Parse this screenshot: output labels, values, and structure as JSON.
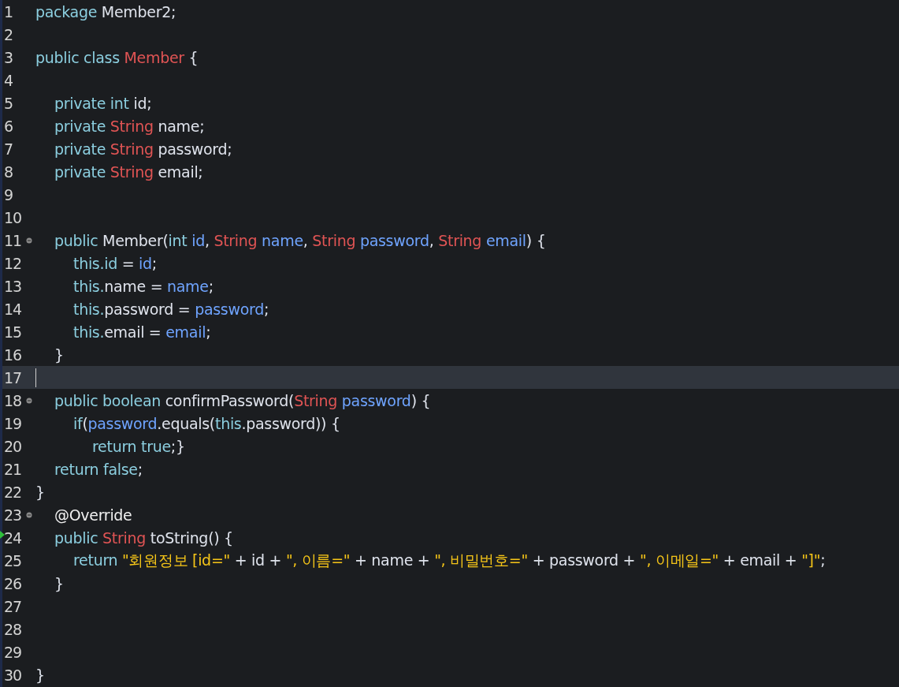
{
  "editor": {
    "lines": [
      {
        "number": "1",
        "tokens": [
          {
            "text": "package",
            "kind": "kw"
          },
          {
            "text": " Member2;",
            "kind": "plain"
          }
        ]
      },
      {
        "number": "2"
      },
      {
        "number": "3",
        "tokens": [
          {
            "text": "public class ",
            "kind": "kw"
          },
          {
            "text": "Member",
            "kind": "type"
          },
          {
            "text": " {",
            "kind": "plain"
          }
        ]
      },
      {
        "number": "4"
      },
      {
        "number": "5",
        "tokens": [
          {
            "text": "\tprivate int ",
            "kind": "kw"
          },
          {
            "text": "id;",
            "kind": "plain"
          }
        ]
      },
      {
        "number": "6",
        "tokens": [
          {
            "text": "\tprivate ",
            "kind": "kw"
          },
          {
            "text": "String",
            "kind": "type"
          },
          {
            "text": " name;",
            "kind": "plain"
          }
        ]
      },
      {
        "number": "7",
        "tokens": [
          {
            "text": "\tprivate ",
            "kind": "kw"
          },
          {
            "text": "String",
            "kind": "type"
          },
          {
            "text": " password;",
            "kind": "plain"
          }
        ]
      },
      {
        "number": "8",
        "tokens": [
          {
            "text": "\tprivate ",
            "kind": "kw"
          },
          {
            "text": "String",
            "kind": "type"
          },
          {
            "text": " email;",
            "kind": "plain"
          }
        ]
      },
      {
        "number": "9"
      },
      {
        "number": "10"
      },
      {
        "number": "11",
        "fold": true,
        "tokens": [
          {
            "text": "\tpublic ",
            "kind": "kw"
          },
          {
            "text": "Member(",
            "kind": "plain"
          },
          {
            "text": "int ",
            "kind": "kw"
          },
          {
            "text": "id",
            "kind": "param"
          },
          {
            "text": ", ",
            "kind": "plain"
          },
          {
            "text": "String ",
            "kind": "type"
          },
          {
            "text": "name",
            "kind": "param"
          },
          {
            "text": ", ",
            "kind": "plain"
          },
          {
            "text": "String ",
            "kind": "type"
          },
          {
            "text": "password",
            "kind": "param"
          },
          {
            "text": ", ",
            "kind": "plain"
          },
          {
            "text": "String ",
            "kind": "type"
          },
          {
            "text": "email",
            "kind": "param"
          },
          {
            "text": ") {",
            "kind": "plain"
          }
        ]
      },
      {
        "number": "12",
        "tokens": [
          {
            "text": "\t\tthis.id",
            "kind": "kw"
          },
          {
            "text": " = ",
            "kind": "plain"
          },
          {
            "text": "id",
            "kind": "param"
          },
          {
            "text": ";",
            "kind": "plain"
          }
        ]
      },
      {
        "number": "13",
        "tokens": [
          {
            "text": "\t\tthis.",
            "kind": "kw"
          },
          {
            "text": "name = ",
            "kind": "plain"
          },
          {
            "text": "name",
            "kind": "param"
          },
          {
            "text": ";",
            "kind": "plain"
          }
        ]
      },
      {
        "number": "14",
        "tokens": [
          {
            "text": "\t\tthis.",
            "kind": "kw"
          },
          {
            "text": "password = ",
            "kind": "plain"
          },
          {
            "text": "password",
            "kind": "param"
          },
          {
            "text": ";",
            "kind": "plain"
          }
        ]
      },
      {
        "number": "15",
        "tokens": [
          {
            "text": "\t\tthis.",
            "kind": "kw"
          },
          {
            "text": "email = ",
            "kind": "plain"
          },
          {
            "text": "email",
            "kind": "param"
          },
          {
            "text": ";",
            "kind": "plain"
          }
        ]
      },
      {
        "number": "16",
        "tokens": [
          {
            "text": "\t}",
            "kind": "plain"
          }
        ]
      },
      {
        "number": "17",
        "current": true
      },
      {
        "number": "18",
        "fold": true,
        "tokens": [
          {
            "text": "\tpublic boolean ",
            "kind": "kw"
          },
          {
            "text": "confirmPassword(",
            "kind": "plain"
          },
          {
            "text": "String ",
            "kind": "type"
          },
          {
            "text": "password",
            "kind": "param"
          },
          {
            "text": ") {",
            "kind": "plain"
          }
        ]
      },
      {
        "number": "19",
        "tokens": [
          {
            "text": "\t\tif",
            "kind": "kw"
          },
          {
            "text": "(",
            "kind": "plain"
          },
          {
            "text": "password",
            "kind": "param"
          },
          {
            "text": ".equals(",
            "kind": "plain"
          },
          {
            "text": "this",
            "kind": "kw"
          },
          {
            "text": ".password)) {",
            "kind": "plain"
          }
        ]
      },
      {
        "number": "20",
        "tokens": [
          {
            "text": "\t\t\treturn true",
            "kind": "kw"
          },
          {
            "text": ";}",
            "kind": "plain"
          }
        ]
      },
      {
        "number": "21",
        "tokens": [
          {
            "text": "\treturn false",
            "kind": "kw"
          },
          {
            "text": ";",
            "kind": "plain"
          }
        ]
      },
      {
        "number": "22",
        "tokens": [
          {
            "text": "}",
            "kind": "plain"
          }
        ]
      },
      {
        "number": "23",
        "fold": true,
        "tokens": [
          {
            "text": "\t@Override",
            "kind": "anno"
          }
        ]
      },
      {
        "number": "24",
        "marker": true,
        "tokens": [
          {
            "text": "\tpublic ",
            "kind": "kw"
          },
          {
            "text": "String",
            "kind": "type"
          },
          {
            "text": " toString() {",
            "kind": "plain"
          }
        ]
      },
      {
        "number": "25",
        "tokens": [
          {
            "text": "\t\treturn ",
            "kind": "kw"
          },
          {
            "text": "\"회원정보 [id=\"",
            "kind": "str"
          },
          {
            "text": " + id + ",
            "kind": "plain"
          },
          {
            "text": "\", 이름=\"",
            "kind": "str"
          },
          {
            "text": " + name + ",
            "kind": "plain"
          },
          {
            "text": "\", 비밀번호=\"",
            "kind": "str"
          },
          {
            "text": " + password + ",
            "kind": "plain"
          },
          {
            "text": "\", 이메일=\"",
            "kind": "str"
          },
          {
            "text": " + email + ",
            "kind": "plain"
          },
          {
            "text": "\"]\"",
            "kind": "str"
          },
          {
            "text": ";",
            "kind": "plain"
          }
        ]
      },
      {
        "number": "26",
        "tokens": [
          {
            "text": "\t}",
            "kind": "plain"
          }
        ]
      },
      {
        "number": "27"
      },
      {
        "number": "28"
      },
      {
        "number": "29"
      },
      {
        "number": "30",
        "tokens": [
          {
            "text": "}",
            "kind": "plain"
          }
        ]
      }
    ]
  }
}
